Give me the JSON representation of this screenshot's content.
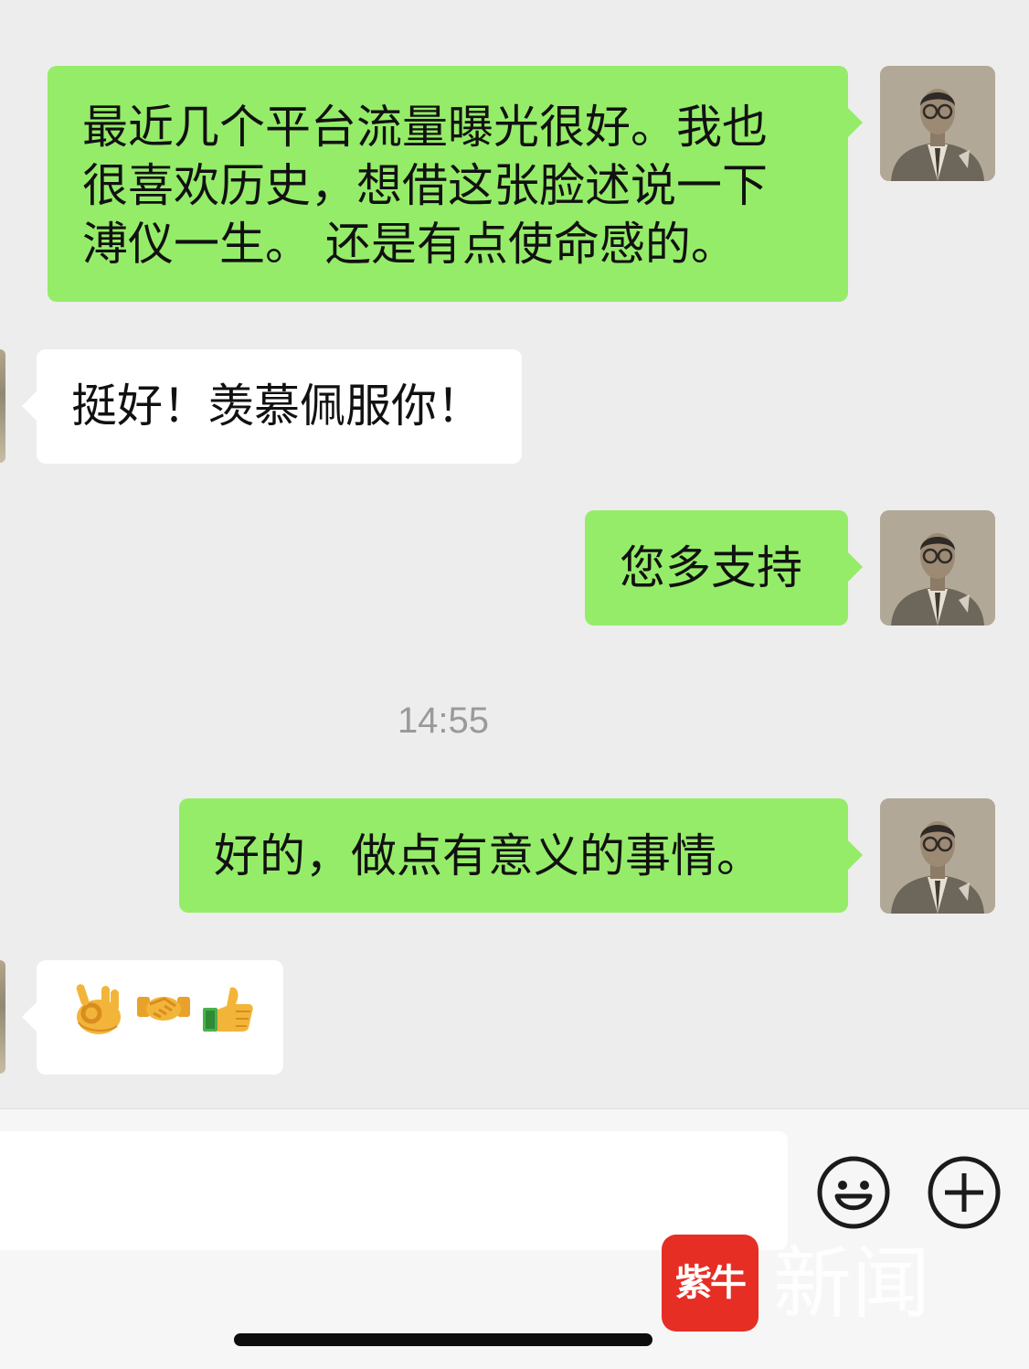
{
  "colors": {
    "background": "#ededed",
    "bubble_self": "#95ec69",
    "bubble_other": "#ffffff",
    "timestamp": "#9a9a9a",
    "watermark_logo": "#e62e25"
  },
  "conversation": {
    "messages": [
      {
        "sender": "self",
        "lines": [
          "最近几个平台流量曝光很好。我也",
          "很喜欢历史，想借这张脸述说一下",
          "溥仪一生。 还是有点使命感的。"
        ]
      },
      {
        "sender": "other",
        "lines": [
          "挺好！羡慕佩服你！"
        ]
      },
      {
        "sender": "self",
        "lines": [
          "您多支持"
        ]
      },
      {
        "sender": "self",
        "lines": [
          "好的，做点有意义的事情。"
        ]
      },
      {
        "sender": "other",
        "emoji": [
          "ok-hand-emoji",
          "handshake-emoji",
          "thumbs-up-emoji"
        ]
      }
    ],
    "timestamp": "14:55"
  },
  "input_bar": {
    "emoji_button_icon": "smiley-icon",
    "more_button_icon": "plus-circle-icon"
  },
  "watermark": {
    "logo_text": "紫牛",
    "text": "新闻"
  }
}
